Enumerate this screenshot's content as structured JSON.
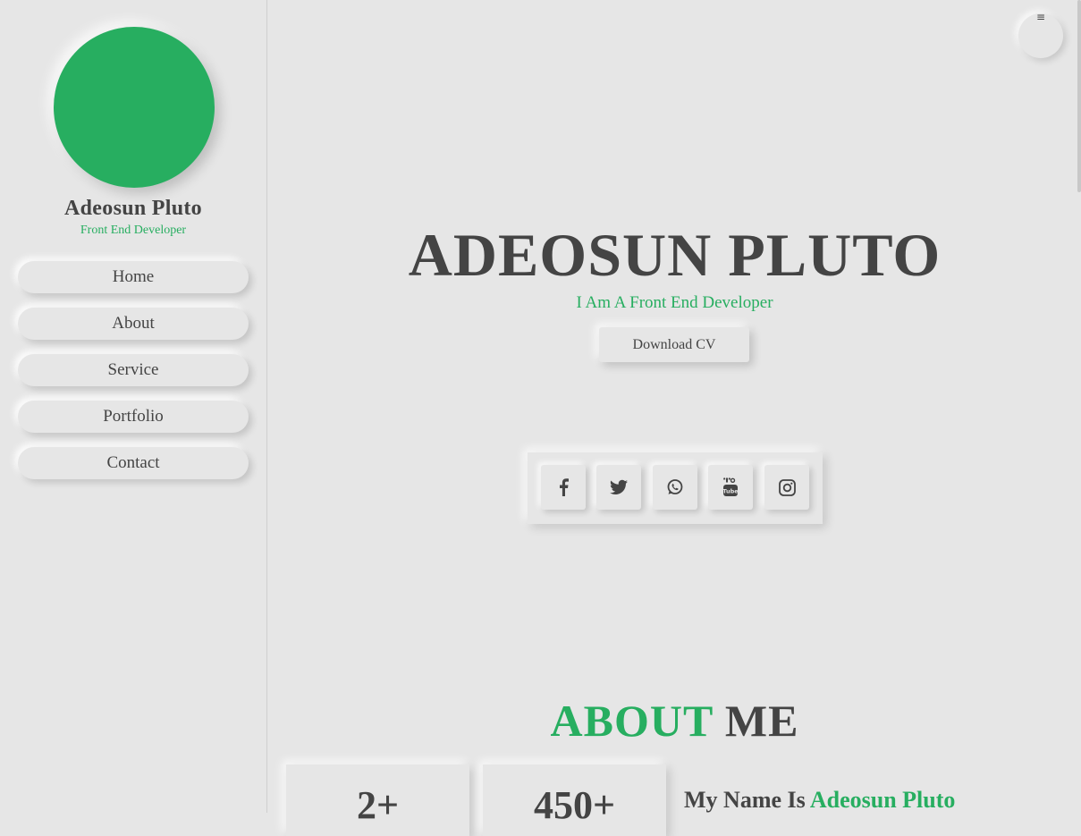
{
  "colors": {
    "accent": "#27ae60",
    "text": "#444444",
    "background": "#e6e6e6"
  },
  "sidebar": {
    "name": "Adeosun Pluto",
    "role": "Front End Developer",
    "nav": [
      {
        "label": "Home"
      },
      {
        "label": "About"
      },
      {
        "label": "Service"
      },
      {
        "label": "Portfolio"
      },
      {
        "label": "Contact"
      }
    ]
  },
  "header": {
    "menu_icon": "≡"
  },
  "hero": {
    "title": "ADEOSUN PLUTO",
    "subtitle": "I Am A Front End Developer",
    "cv_button": "Download CV",
    "social_icons": [
      "facebook-icon",
      "twitter-icon",
      "whatsapp-icon",
      "youtube-icon",
      "instagram-icon"
    ]
  },
  "about": {
    "heading_accent": "ABOUT",
    "heading_rest": "ME",
    "stats": [
      {
        "value": "2+"
      },
      {
        "value": "450+"
      }
    ],
    "intro_prefix": "My Name Is",
    "intro_name": "Adeosun Pluto"
  }
}
